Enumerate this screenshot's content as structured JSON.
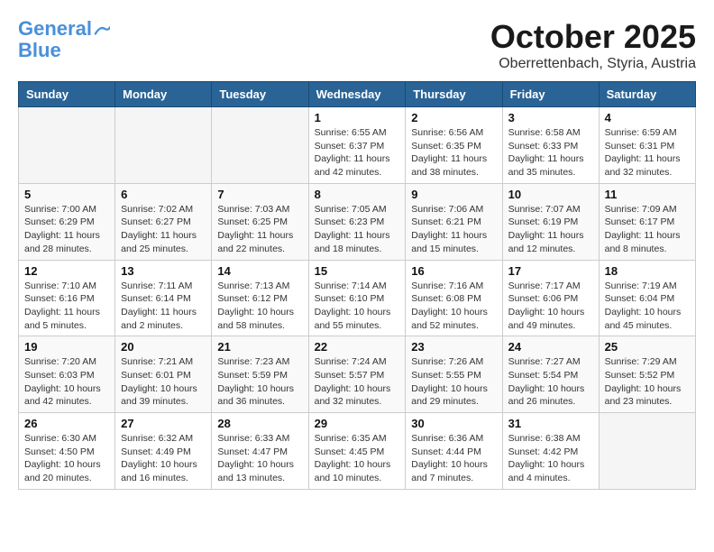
{
  "header": {
    "logo_general": "General",
    "logo_blue": "Blue",
    "month_title": "October 2025",
    "location": "Oberrettenbach, Styria, Austria"
  },
  "weekdays": [
    "Sunday",
    "Monday",
    "Tuesday",
    "Wednesday",
    "Thursday",
    "Friday",
    "Saturday"
  ],
  "weeks": [
    [
      {
        "day": "",
        "info": ""
      },
      {
        "day": "",
        "info": ""
      },
      {
        "day": "",
        "info": ""
      },
      {
        "day": "1",
        "info": "Sunrise: 6:55 AM\nSunset: 6:37 PM\nDaylight: 11 hours\nand 42 minutes."
      },
      {
        "day": "2",
        "info": "Sunrise: 6:56 AM\nSunset: 6:35 PM\nDaylight: 11 hours\nand 38 minutes."
      },
      {
        "day": "3",
        "info": "Sunrise: 6:58 AM\nSunset: 6:33 PM\nDaylight: 11 hours\nand 35 minutes."
      },
      {
        "day": "4",
        "info": "Sunrise: 6:59 AM\nSunset: 6:31 PM\nDaylight: 11 hours\nand 32 minutes."
      }
    ],
    [
      {
        "day": "5",
        "info": "Sunrise: 7:00 AM\nSunset: 6:29 PM\nDaylight: 11 hours\nand 28 minutes."
      },
      {
        "day": "6",
        "info": "Sunrise: 7:02 AM\nSunset: 6:27 PM\nDaylight: 11 hours\nand 25 minutes."
      },
      {
        "day": "7",
        "info": "Sunrise: 7:03 AM\nSunset: 6:25 PM\nDaylight: 11 hours\nand 22 minutes."
      },
      {
        "day": "8",
        "info": "Sunrise: 7:05 AM\nSunset: 6:23 PM\nDaylight: 11 hours\nand 18 minutes."
      },
      {
        "day": "9",
        "info": "Sunrise: 7:06 AM\nSunset: 6:21 PM\nDaylight: 11 hours\nand 15 minutes."
      },
      {
        "day": "10",
        "info": "Sunrise: 7:07 AM\nSunset: 6:19 PM\nDaylight: 11 hours\nand 12 minutes."
      },
      {
        "day": "11",
        "info": "Sunrise: 7:09 AM\nSunset: 6:17 PM\nDaylight: 11 hours\nand 8 minutes."
      }
    ],
    [
      {
        "day": "12",
        "info": "Sunrise: 7:10 AM\nSunset: 6:16 PM\nDaylight: 11 hours\nand 5 minutes."
      },
      {
        "day": "13",
        "info": "Sunrise: 7:11 AM\nSunset: 6:14 PM\nDaylight: 11 hours\nand 2 minutes."
      },
      {
        "day": "14",
        "info": "Sunrise: 7:13 AM\nSunset: 6:12 PM\nDaylight: 10 hours\nand 58 minutes."
      },
      {
        "day": "15",
        "info": "Sunrise: 7:14 AM\nSunset: 6:10 PM\nDaylight: 10 hours\nand 55 minutes."
      },
      {
        "day": "16",
        "info": "Sunrise: 7:16 AM\nSunset: 6:08 PM\nDaylight: 10 hours\nand 52 minutes."
      },
      {
        "day": "17",
        "info": "Sunrise: 7:17 AM\nSunset: 6:06 PM\nDaylight: 10 hours\nand 49 minutes."
      },
      {
        "day": "18",
        "info": "Sunrise: 7:19 AM\nSunset: 6:04 PM\nDaylight: 10 hours\nand 45 minutes."
      }
    ],
    [
      {
        "day": "19",
        "info": "Sunrise: 7:20 AM\nSunset: 6:03 PM\nDaylight: 10 hours\nand 42 minutes."
      },
      {
        "day": "20",
        "info": "Sunrise: 7:21 AM\nSunset: 6:01 PM\nDaylight: 10 hours\nand 39 minutes."
      },
      {
        "day": "21",
        "info": "Sunrise: 7:23 AM\nSunset: 5:59 PM\nDaylight: 10 hours\nand 36 minutes."
      },
      {
        "day": "22",
        "info": "Sunrise: 7:24 AM\nSunset: 5:57 PM\nDaylight: 10 hours\nand 32 minutes."
      },
      {
        "day": "23",
        "info": "Sunrise: 7:26 AM\nSunset: 5:55 PM\nDaylight: 10 hours\nand 29 minutes."
      },
      {
        "day": "24",
        "info": "Sunrise: 7:27 AM\nSunset: 5:54 PM\nDaylight: 10 hours\nand 26 minutes."
      },
      {
        "day": "25",
        "info": "Sunrise: 7:29 AM\nSunset: 5:52 PM\nDaylight: 10 hours\nand 23 minutes."
      }
    ],
    [
      {
        "day": "26",
        "info": "Sunrise: 6:30 AM\nSunset: 4:50 PM\nDaylight: 10 hours\nand 20 minutes."
      },
      {
        "day": "27",
        "info": "Sunrise: 6:32 AM\nSunset: 4:49 PM\nDaylight: 10 hours\nand 16 minutes."
      },
      {
        "day": "28",
        "info": "Sunrise: 6:33 AM\nSunset: 4:47 PM\nDaylight: 10 hours\nand 13 minutes."
      },
      {
        "day": "29",
        "info": "Sunrise: 6:35 AM\nSunset: 4:45 PM\nDaylight: 10 hours\nand 10 minutes."
      },
      {
        "day": "30",
        "info": "Sunrise: 6:36 AM\nSunset: 4:44 PM\nDaylight: 10 hours\nand 7 minutes."
      },
      {
        "day": "31",
        "info": "Sunrise: 6:38 AM\nSunset: 4:42 PM\nDaylight: 10 hours\nand 4 minutes."
      },
      {
        "day": "",
        "info": ""
      }
    ]
  ]
}
